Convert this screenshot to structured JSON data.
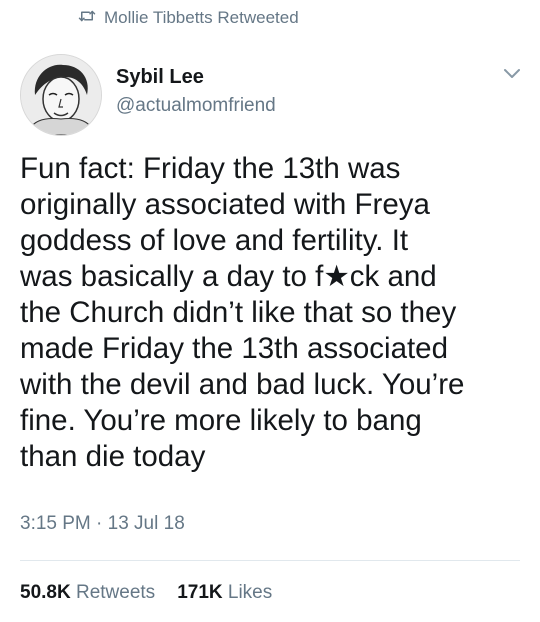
{
  "retweet_context": {
    "text": "Mollie Tibbetts Retweeted",
    "icon": "retweet-icon"
  },
  "author": {
    "name": "Sybil Lee",
    "handle": "@actualmomfriend",
    "avatar_icon": "avatar-portrait"
  },
  "tweet": {
    "text": "Fun fact: Friday the 13th was\noriginally associated with Freya\ngoddess of love and fertility. It\nwas basically a day to f★ck and\nthe Church didn’t like that so they\nmade Friday the 13th associated\nwith the devil and bad luck. You’re\nfine. You’re more likely to bang\nthan die today",
    "timestamp": "3:15 PM · 13 Jul 18"
  },
  "stats": {
    "retweets_count": "50.8K",
    "retweets_label": "Retweets",
    "likes_count": "171K",
    "likes_label": "Likes"
  },
  "colors": {
    "text": "#14171a",
    "muted": "#657786",
    "divider": "#e1e8ed"
  }
}
